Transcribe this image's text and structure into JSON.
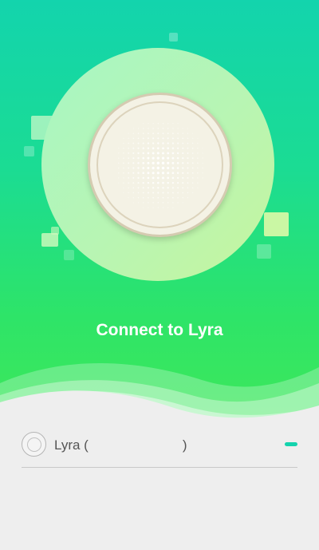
{
  "screen": {
    "title": "Connect to Lyra"
  },
  "device_list": {
    "items": [
      {
        "name": "Lyra (                         )",
        "status_color": "#14d3ad"
      }
    ]
  },
  "colors": {
    "gradient_top": "#13d4ad",
    "gradient_bottom": "#3ee85a",
    "accent": "#14d3ad",
    "list_background": "#eeeeee"
  },
  "icons": {
    "device": "speaker-device-illustration",
    "avatar": "device-avatar-icon",
    "status": "connection-status-indicator"
  }
}
